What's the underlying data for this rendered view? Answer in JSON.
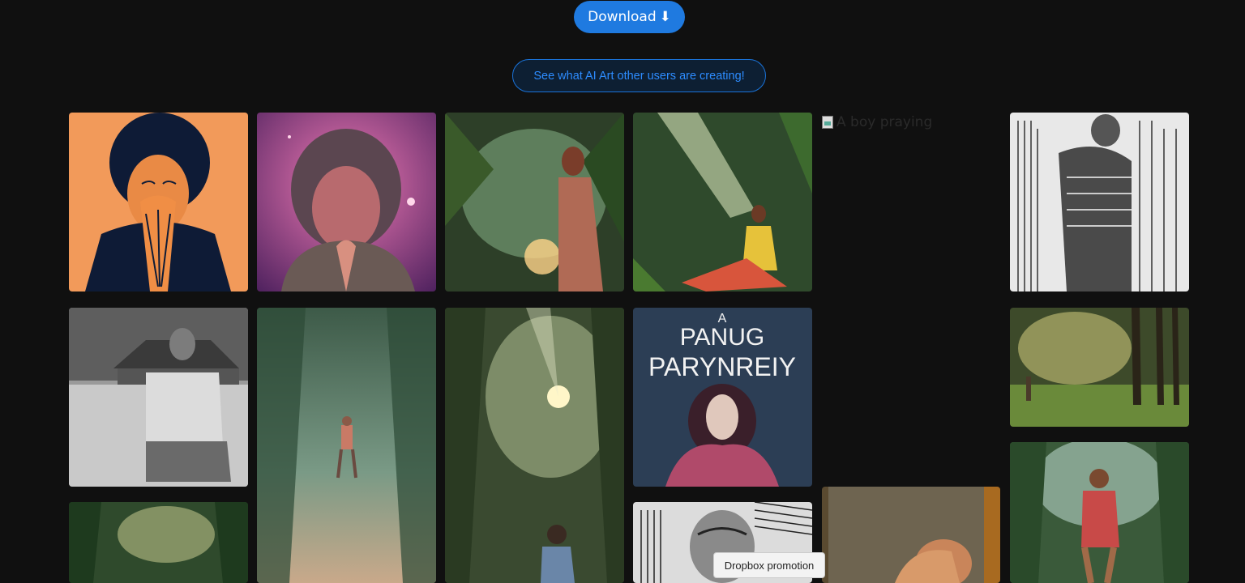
{
  "header": {
    "download_label": "Download",
    "download_glyph": "⬇",
    "see_label": "See what AI Art other users are creating!"
  },
  "gallery": {
    "broken_image_alt": "A boy praying",
    "items": [
      {
        "desc": "woman-praying-afro-illustration"
      },
      {
        "desc": "girl-praying-pink-fur"
      },
      {
        "desc": "woman-jungle-glow"
      },
      {
        "desc": "woman-jungle-lightbeam"
      },
      {
        "desc": "engraving-man-door"
      },
      {
        "desc": "man-kneeling-bw-photo"
      },
      {
        "desc": "person-misty-forest-tall"
      },
      {
        "desc": "boy-forest-sunrays-tall"
      },
      {
        "desc": "poster-woman-hands-face"
      },
      {
        "desc": "boy-forest-small"
      },
      {
        "desc": "forest-bottom-left"
      },
      {
        "desc": "engraving-old-man-bottom"
      },
      {
        "desc": "painting-figure-bottom"
      },
      {
        "desc": "boy-praying-forest-bottom-right"
      }
    ],
    "poster_line1": "PANUG",
    "poster_line2": "PARYNREIY",
    "poster_small": "A"
  },
  "tooltip": {
    "text": "Dropbox promotion"
  }
}
